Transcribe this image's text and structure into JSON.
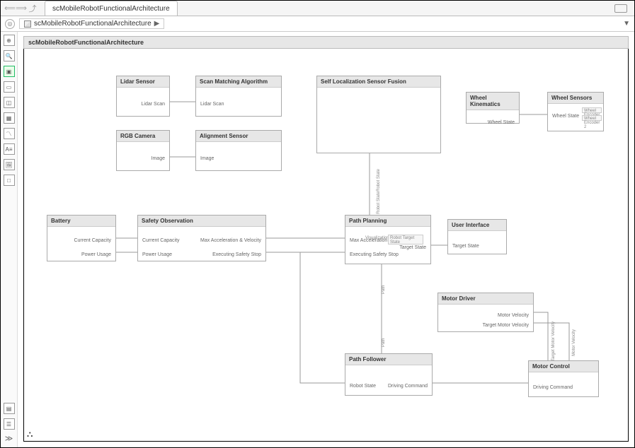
{
  "tab": {
    "title": "scMobileRobotFunctionalArchitecture"
  },
  "breadcrumb": {
    "item": "scMobileRobotFunctionalArchitecture"
  },
  "canvas": {
    "title": "scMobileRobotFunctionalArchitecture"
  },
  "blocks": {
    "lidar": {
      "title": "Lidar Sensor",
      "out1": "Lidar Scan"
    },
    "scanMatch": {
      "title": "Scan Matching Algorithm",
      "in1": "Lidar Scan"
    },
    "rgb": {
      "title": "RGB Camera",
      "out1": "Image"
    },
    "align": {
      "title": "Alignment Sensor",
      "in1": "Image"
    },
    "slf": {
      "title": "Self Localization Sensor Fusion"
    },
    "wheelKin": {
      "title": "Wheel Kinematics",
      "out1": "Wheel State"
    },
    "wheelSen": {
      "title": "Wheel Sensors",
      "in1": "Wheel State",
      "inner1": "Wheel Encoder 1",
      "inner2": "Wheel Encoder 2"
    },
    "battery": {
      "title": "Battery",
      "out1": "Current Capacity",
      "out2": "Power Usage"
    },
    "safety": {
      "title": "Safety Observation",
      "in1": "Current Capacity",
      "in2": "Power Usage",
      "out1": "Max Acceleration & Velocity",
      "out2": "Executing Safety Stop"
    },
    "path": {
      "title": "Path Planning",
      "in1": "Max Acceleration & Velocity",
      "in2": "Executing Safety Stop",
      "in3": "Target State",
      "inner1": "Robot Target State",
      "innerLabel": "Visualization"
    },
    "ui": {
      "title": "User Interface",
      "out1": "Target State"
    },
    "motorDriver": {
      "title": "Motor Driver",
      "out1": "Motor Velocity",
      "out2": "Target Motor Velocity"
    },
    "follower": {
      "title": "Path Follower",
      "in1": "Robot State",
      "out1": "Driving Command"
    },
    "motorCtrl": {
      "title": "Motor Control",
      "in1": "Driving Command"
    }
  },
  "edgeLabels": {
    "robotState1": "Robot State",
    "robotState2": "Robot State",
    "path1": "Path",
    "path2": "Path",
    "targetMotorVel": "Target Motor Velocity",
    "motorVel": "Motor Velocity"
  }
}
